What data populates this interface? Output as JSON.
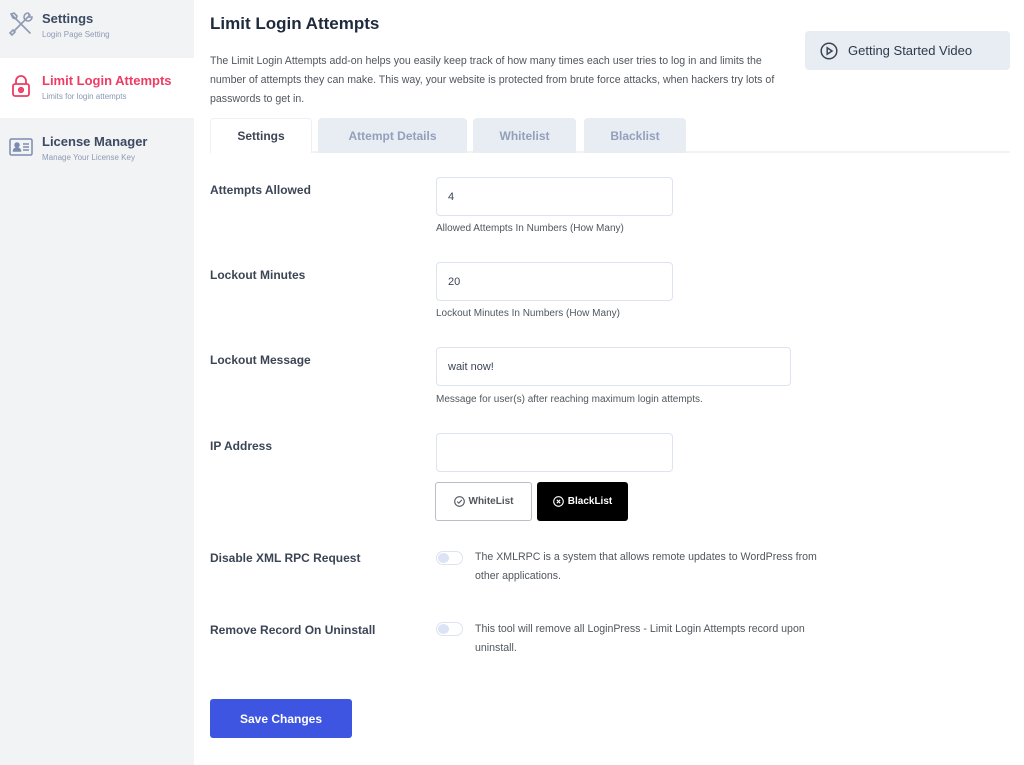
{
  "sidebar": {
    "items": [
      {
        "title": "Settings",
        "subtitle": "Login Page Setting",
        "icon": "tools-icon",
        "active": false
      },
      {
        "title": "Limit Login Attempts",
        "subtitle": "Limits for login attempts",
        "icon": "lock-icon",
        "active": true
      },
      {
        "title": "License Manager",
        "subtitle": "Manage Your License Key",
        "icon": "id-card-icon",
        "active": false
      }
    ]
  },
  "header": {
    "title": "Limit Login Attempts",
    "description": "The Limit Login Attempts add-on helps you easily keep track of how many times each user tries to log in and limits the number of attempts they can make. This way, your website is protected from brute force attacks, when hackers try lots of passwords to get in.",
    "video_button": "Getting Started Video"
  },
  "tabs": [
    {
      "label": "Settings",
      "active": true
    },
    {
      "label": "Attempt Details",
      "active": false
    },
    {
      "label": "Whitelist",
      "active": false
    },
    {
      "label": "Blacklist",
      "active": false
    }
  ],
  "form": {
    "attempts_allowed": {
      "label": "Attempts Allowed",
      "value": "4",
      "hint": "Allowed Attempts In Numbers (How Many)"
    },
    "lockout_minutes": {
      "label": "Lockout Minutes",
      "value": "20",
      "hint": "Lockout Minutes In Numbers (How Many)"
    },
    "lockout_message": {
      "label": "Lockout Message",
      "value": "wait now!",
      "hint": "Message for user(s) after reaching maximum login attempts."
    },
    "ip_address": {
      "label": "IP Address",
      "value": "",
      "whitelist_button": "WhiteList",
      "blacklist_button": "BlackList"
    },
    "disable_xmlrpc": {
      "label": "Disable XML RPC Request",
      "enabled": false,
      "description": "The XMLRPC is a system that allows remote updates to WordPress from other applications."
    },
    "remove_record": {
      "label": "Remove Record On Uninstall",
      "enabled": false,
      "description": "This tool will remove all LoginPress - Limit Login Attempts record upon uninstall."
    }
  },
  "save_button": "Save Changes",
  "colors": {
    "accent_red": "#ef3b63",
    "primary_blue": "#3d55e0",
    "sidebar_bg": "#f1f3f5",
    "tab_bg": "#e8ecf3"
  }
}
